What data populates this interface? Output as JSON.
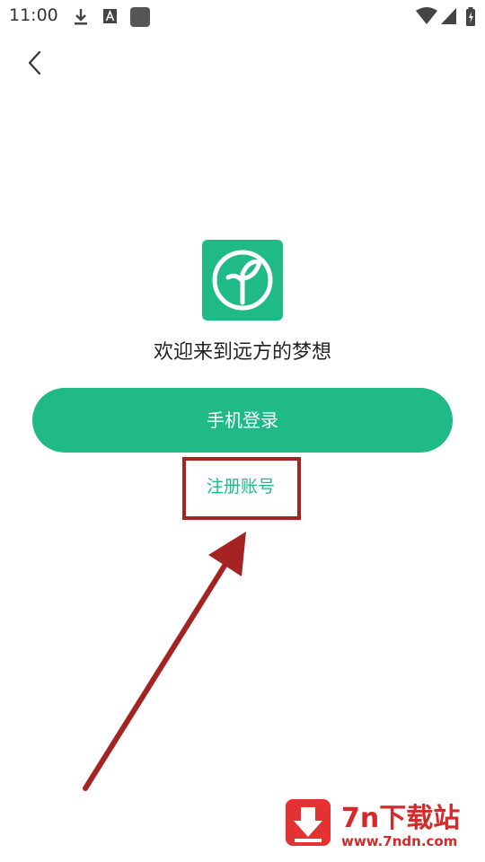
{
  "status_bar": {
    "time": "11:00",
    "icons": [
      "download-icon",
      "font-a-icon",
      "app-square-icon",
      "wifi-icon",
      "cell-signal-icon",
      "battery-icon"
    ]
  },
  "nav": {
    "back_icon": "chevron-left-icon"
  },
  "logo": {
    "icon": "sprout-icon",
    "color": "#1fba86"
  },
  "welcome_text": "欢迎来到远方的梦想",
  "login_button_label": "手机登录",
  "register_link_label": "注册账号",
  "annotation": {
    "highlight_color": "#a52323",
    "arrow_color": "#a52323"
  },
  "watermark": {
    "title": "7n下载站",
    "url": "www.7ndn.com",
    "color": "#d42a2a"
  },
  "colors": {
    "accent": "#1fba86",
    "background": "#ffffff"
  }
}
